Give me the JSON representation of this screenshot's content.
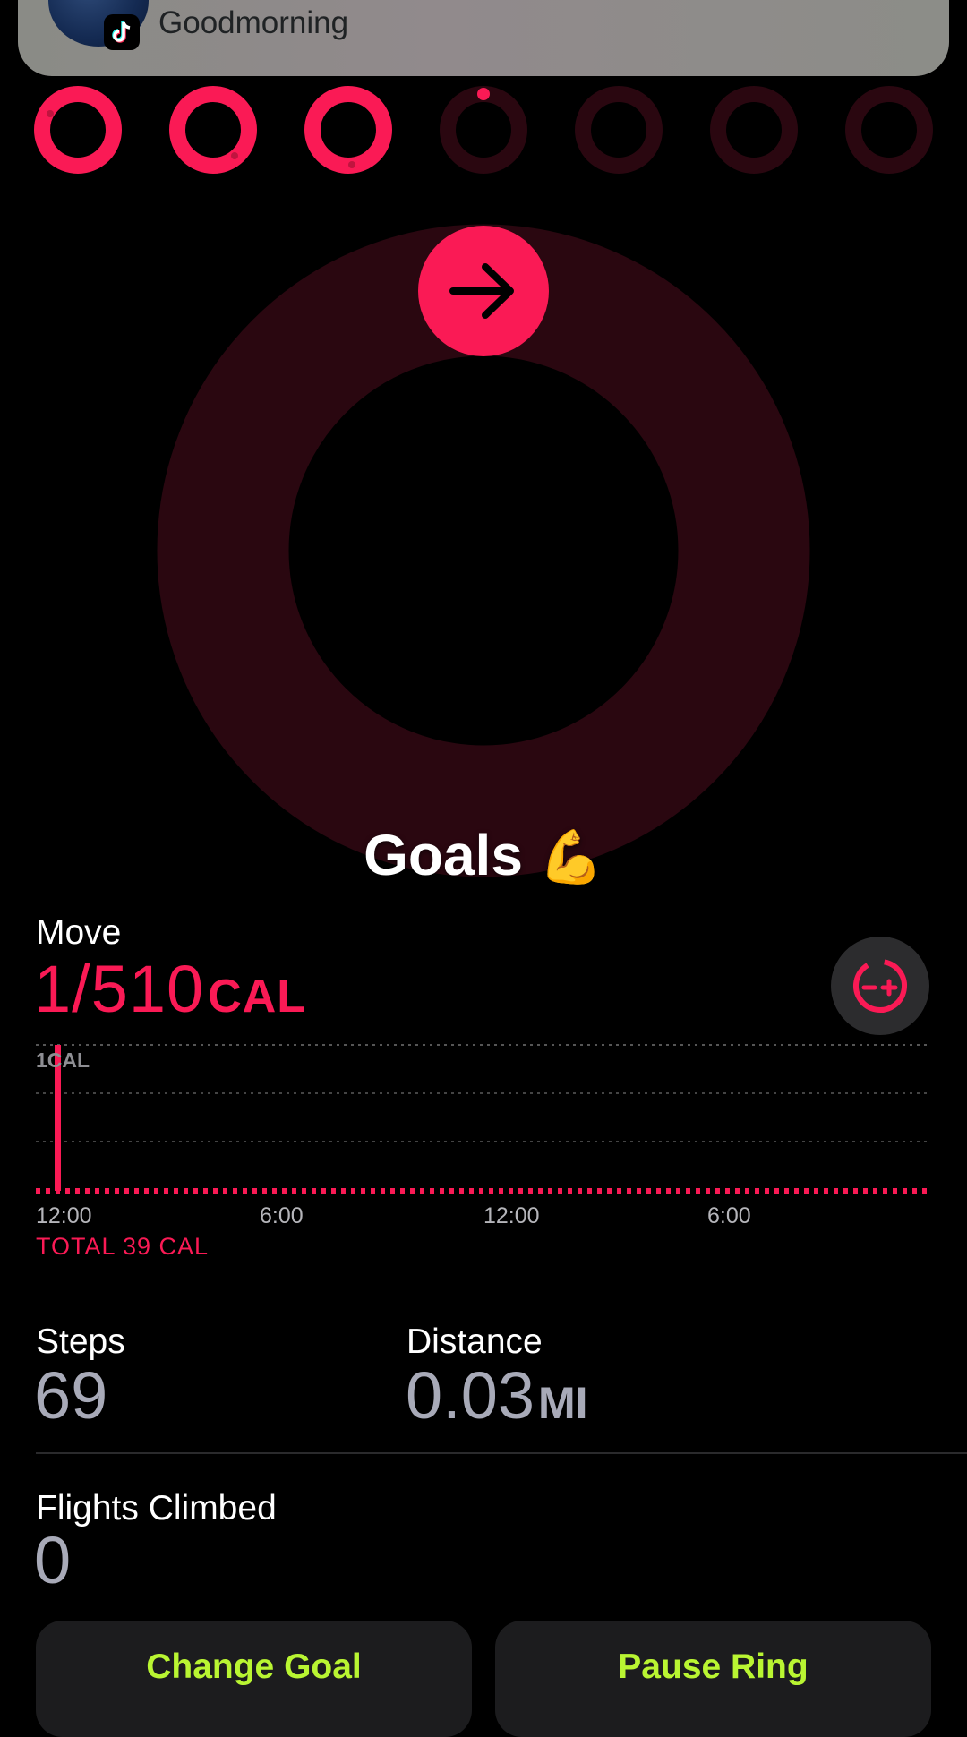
{
  "notification": {
    "message": "Goodmorning",
    "app_icon": "tiktok-icon"
  },
  "week_rings": [
    {
      "day_index": 0,
      "complete": true
    },
    {
      "day_index": 1,
      "complete": true
    },
    {
      "day_index": 2,
      "complete": true
    },
    {
      "day_index": 3,
      "complete": false,
      "today": true
    },
    {
      "day_index": 4,
      "complete": false
    },
    {
      "day_index": 5,
      "complete": false
    },
    {
      "day_index": 6,
      "complete": false
    }
  ],
  "move_ring": {
    "progress": 0.002,
    "icon": "arrow-right-icon"
  },
  "caption": {
    "text": "Goals",
    "emoji": "💪"
  },
  "move": {
    "title": "Move",
    "value": "1/510",
    "unit": "CAL"
  },
  "chart_data": {
    "type": "bar",
    "top_gridline_label": "1CAL",
    "x_ticks": [
      "12:00",
      "6:00",
      "12:00",
      "6:00"
    ],
    "values_note": "",
    "bars": [
      {
        "x": "12:00",
        "value": 1
      }
    ],
    "total_label": "TOTAL 39 CAL"
  },
  "steps": {
    "title": "Steps",
    "value": "69"
  },
  "distance": {
    "title": "Distance",
    "value": "0.03",
    "unit": "MI"
  },
  "flights": {
    "title": "Flights Climbed",
    "value": "0"
  },
  "buttons": {
    "change_goal": "Change Goal",
    "pause_ring": "Pause Ring"
  },
  "colors": {
    "move_red": "#fa1a55",
    "ring_track": "#2a0710",
    "button_text": "#b9f532",
    "background": "#000000"
  }
}
